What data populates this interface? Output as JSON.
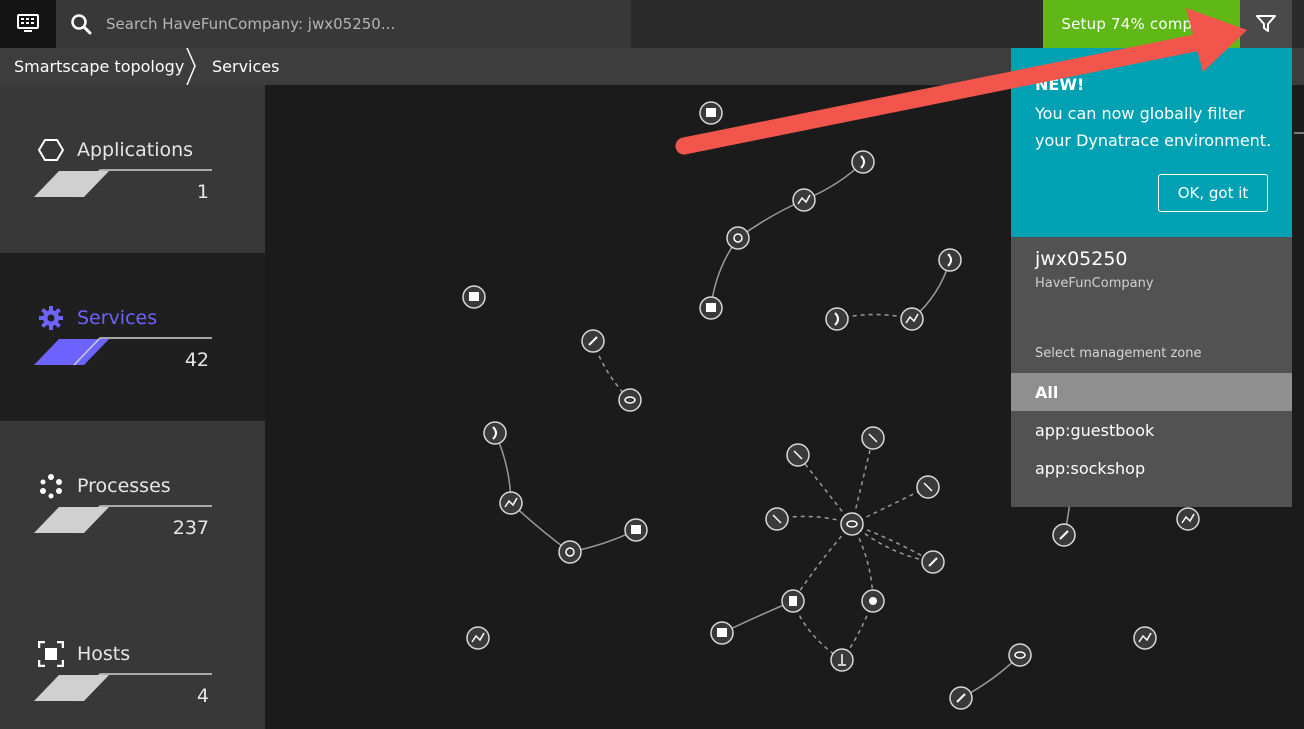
{
  "topbar": {
    "search_placeholder": "Search HaveFunCompany: jwx05250...",
    "setup_label": "Setup 74% complete"
  },
  "breadcrumb": [
    "Smartscape topology",
    "Services"
  ],
  "sidebar": {
    "tiles": [
      {
        "label": "Applications",
        "count": "1",
        "icon": "hexagon-icon"
      },
      {
        "label": "Services",
        "count": "42",
        "icon": "gear-icon"
      },
      {
        "label": "Processes",
        "count": "237",
        "icon": "process-icon"
      },
      {
        "label": "Hosts",
        "count": "4",
        "icon": "host-icon"
      }
    ]
  },
  "popover": {
    "new_label": "NEW!",
    "notice_text": "You can now globally filter your Dynatrace environment.",
    "ok_label": "OK, got it",
    "env_name": "jwx05250",
    "env_company": "HaveFunCompany",
    "zone_label": "Select management zone",
    "zones": [
      "All",
      "app:guestbook",
      "app:sockshop"
    ]
  },
  "colors": {
    "accent": "#6d63ff",
    "setup": "#5fb816",
    "notice": "#00a1b2",
    "arrow": "#f2554b"
  }
}
